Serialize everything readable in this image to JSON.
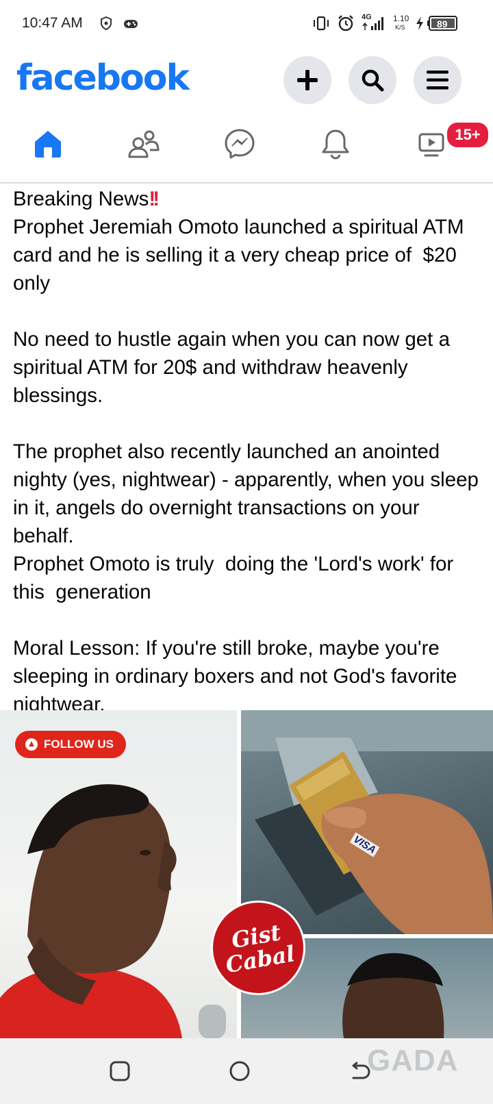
{
  "status_bar": {
    "time": "10:47 AM",
    "network": "4G",
    "speed_value": "1.10",
    "speed_unit": "K/S",
    "battery": "89"
  },
  "header": {
    "logo_text": "facebook",
    "icons": [
      "plus-icon",
      "search-icon",
      "menu-icon"
    ]
  },
  "nav": {
    "tabs": [
      "home-icon",
      "friends-icon",
      "messenger-icon",
      "notifications-icon",
      "video-icon"
    ],
    "video_badge": "15+"
  },
  "post": {
    "heading": "Breaking News",
    "heading_emoji": "!!",
    "body": "Prophet Jeremiah Omoto launched a spiritual ATM card and he is selling it a very cheap price of  $20 only\n\nNo need to hustle again when you can now get a spiritual ATM for 20$ and withdraw heavenly blessings.\n\nThe prophet also recently launched an anointed nighty (yes, nightwear) - apparently, when you sleep in it, angels do overnight transactions on your behalf.\nProphet Omoto is truly  doing the 'Lord's work' for this  generation\n\nMoral Lesson: If you're still broke, maybe you're sleeping in ordinary boxers and not God's favorite nightwear.",
    "images": {
      "follow_label": "FOLLOW US",
      "brand_line1": "Gist",
      "brand_line2": "Cabal",
      "card_brand": "VISA"
    }
  },
  "watermark": "GADA",
  "colors": {
    "brand": "#1877f2",
    "badge": "#e41e3f",
    "icon_bg": "#e4e6eb"
  }
}
